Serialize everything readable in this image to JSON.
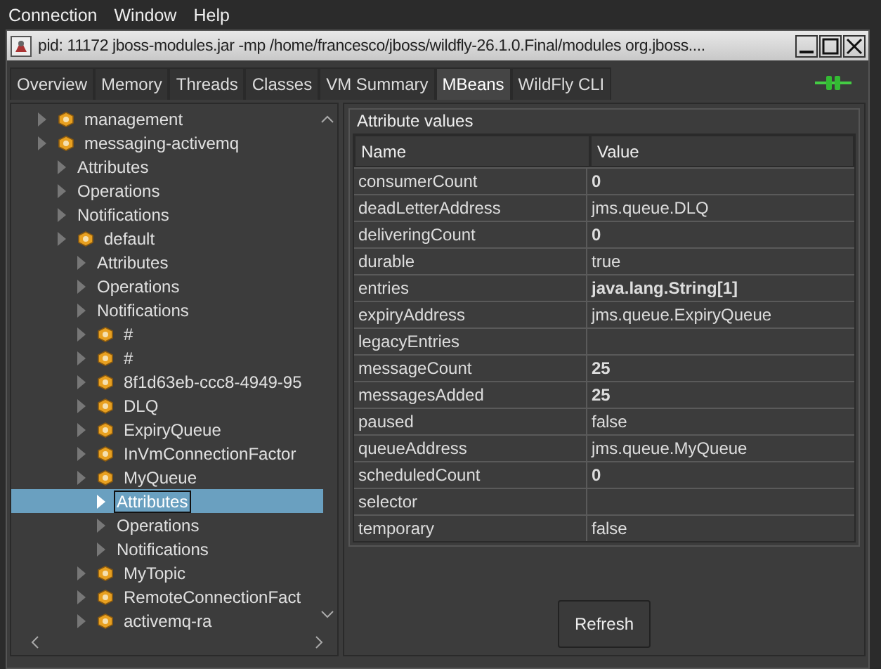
{
  "menu": [
    {
      "label": "Connection"
    },
    {
      "label": "Window"
    },
    {
      "label": "Help"
    }
  ],
  "window": {
    "title": "pid: 11172 jboss-modules.jar -mp /home/francesco/jboss/wildfly-26.1.0.Final/modules org.jboss...."
  },
  "tabs": [
    {
      "label": "Overview",
      "selected": false
    },
    {
      "label": "Memory",
      "selected": false
    },
    {
      "label": "Threads",
      "selected": false
    },
    {
      "label": "Classes",
      "selected": false
    },
    {
      "label": "VM Summary",
      "selected": false
    },
    {
      "label": "MBeans",
      "selected": true
    },
    {
      "label": "WildFly CLI",
      "selected": false
    }
  ],
  "tree": [
    {
      "label": "management",
      "kind": "mbean",
      "selected": false
    },
    {
      "label": "messaging-activemq",
      "kind": "mbean",
      "selected": false,
      "children": [
        {
          "label": "Attributes",
          "kind": "node",
          "selected": false
        },
        {
          "label": "Operations",
          "kind": "node",
          "selected": false
        },
        {
          "label": "Notifications",
          "kind": "node",
          "selected": false
        },
        {
          "label": "default",
          "kind": "mbean",
          "selected": false,
          "children": [
            {
              "label": "Attributes",
              "kind": "node",
              "selected": false
            },
            {
              "label": "Operations",
              "kind": "node",
              "selected": false
            },
            {
              "label": "Notifications",
              "kind": "node",
              "selected": false
            },
            {
              "label": "#",
              "kind": "mbean",
              "selected": false
            },
            {
              "label": "#",
              "kind": "mbean",
              "selected": false
            },
            {
              "label": "8f1d63eb-ccc8-4949-95",
              "kind": "mbean",
              "selected": false
            },
            {
              "label": "DLQ",
              "kind": "mbean",
              "selected": false
            },
            {
              "label": "ExpiryQueue",
              "kind": "mbean",
              "selected": false
            },
            {
              "label": "InVmConnectionFactor",
              "kind": "mbean",
              "selected": false
            },
            {
              "label": "MyQueue",
              "kind": "mbean",
              "selected": false,
              "children": [
                {
                  "label": "Attributes",
                  "kind": "node",
                  "selected": true
                },
                {
                  "label": "Operations",
                  "kind": "node",
                  "selected": false
                },
                {
                  "label": "Notifications",
                  "kind": "node",
                  "selected": false
                }
              ]
            },
            {
              "label": "MyTopic",
              "kind": "mbean",
              "selected": false
            },
            {
              "label": "RemoteConnectionFact",
              "kind": "mbean",
              "selected": false
            },
            {
              "label": "activemq-ra",
              "kind": "mbean",
              "selected": false
            }
          ]
        }
      ]
    }
  ],
  "attributes": {
    "title": "Attribute values",
    "columns": [
      "Name",
      "Value"
    ],
    "rows": [
      {
        "name": "consumerCount",
        "value": "0",
        "bold": true
      },
      {
        "name": "deadLetterAddress",
        "value": "jms.queue.DLQ",
        "bold": false
      },
      {
        "name": "deliveringCount",
        "value": "0",
        "bold": true
      },
      {
        "name": "durable",
        "value": "true",
        "bold": false
      },
      {
        "name": "entries",
        "value": "java.lang.String[1]",
        "bold": true
      },
      {
        "name": "expiryAddress",
        "value": "jms.queue.ExpiryQueue",
        "bold": false
      },
      {
        "name": "legacyEntries"
      },
      {
        "name": "messageCount",
        "value": "25",
        "bold": true
      },
      {
        "name": "messagesAdded",
        "value": "25",
        "bold": true
      },
      {
        "name": "paused",
        "value": "false",
        "bold": false
      },
      {
        "name": "queueAddress",
        "value": "jms.queue.MyQueue",
        "bold": false
      },
      {
        "name": "scheduledCount",
        "value": "0",
        "bold": true
      },
      {
        "name": "selector"
      },
      {
        "name": "temporary",
        "value": "false",
        "bold": false
      }
    ],
    "button": "Refresh"
  }
}
